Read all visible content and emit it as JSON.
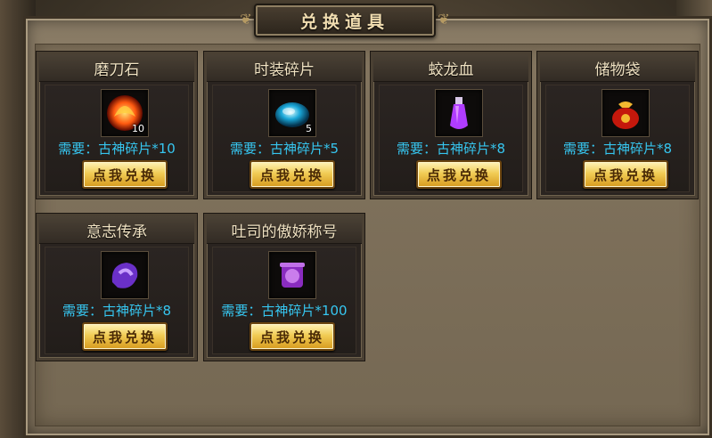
{
  "window": {
    "title": "兑换道具"
  },
  "items": [
    {
      "name": "磨刀石",
      "icon": "whetstone-icon",
      "qty": "10",
      "need": "需要：古神碎片*10",
      "button": "点我兑换",
      "colors": [
        "#ff5a10",
        "#ffd040"
      ]
    },
    {
      "name": "时装碎片",
      "icon": "fashion-shard-icon",
      "qty": "5",
      "need": "需要：古神碎片*5",
      "button": "点我兑换",
      "colors": [
        "#1aa7d8",
        "#9cf2ff"
      ]
    },
    {
      "name": "蛟龙血",
      "icon": "dragon-blood-potion-icon",
      "qty": "",
      "need": "需要：古神碎片*8",
      "button": "点我兑换",
      "colors": [
        "#b03cff",
        "#f0b0ff"
      ]
    },
    {
      "name": "储物袋",
      "icon": "storage-bag-icon",
      "qty": "",
      "need": "需要：古神碎片*8",
      "button": "点我兑换",
      "colors": [
        "#c4180c",
        "#f2b830"
      ]
    },
    {
      "name": "意志传承",
      "icon": "will-inheritance-icon",
      "qty": "",
      "need": "需要：古神碎片*8",
      "button": "点我兑换",
      "colors": [
        "#6a30c8",
        "#c8a0ff"
      ]
    },
    {
      "name": "吐司的傲娇称号",
      "icon": "title-scroll-icon",
      "qty": "",
      "need": "需要：古神碎片*100",
      "button": "点我兑换",
      "colors": [
        "#8a2cc0",
        "#e6a0ff"
      ]
    }
  ]
}
